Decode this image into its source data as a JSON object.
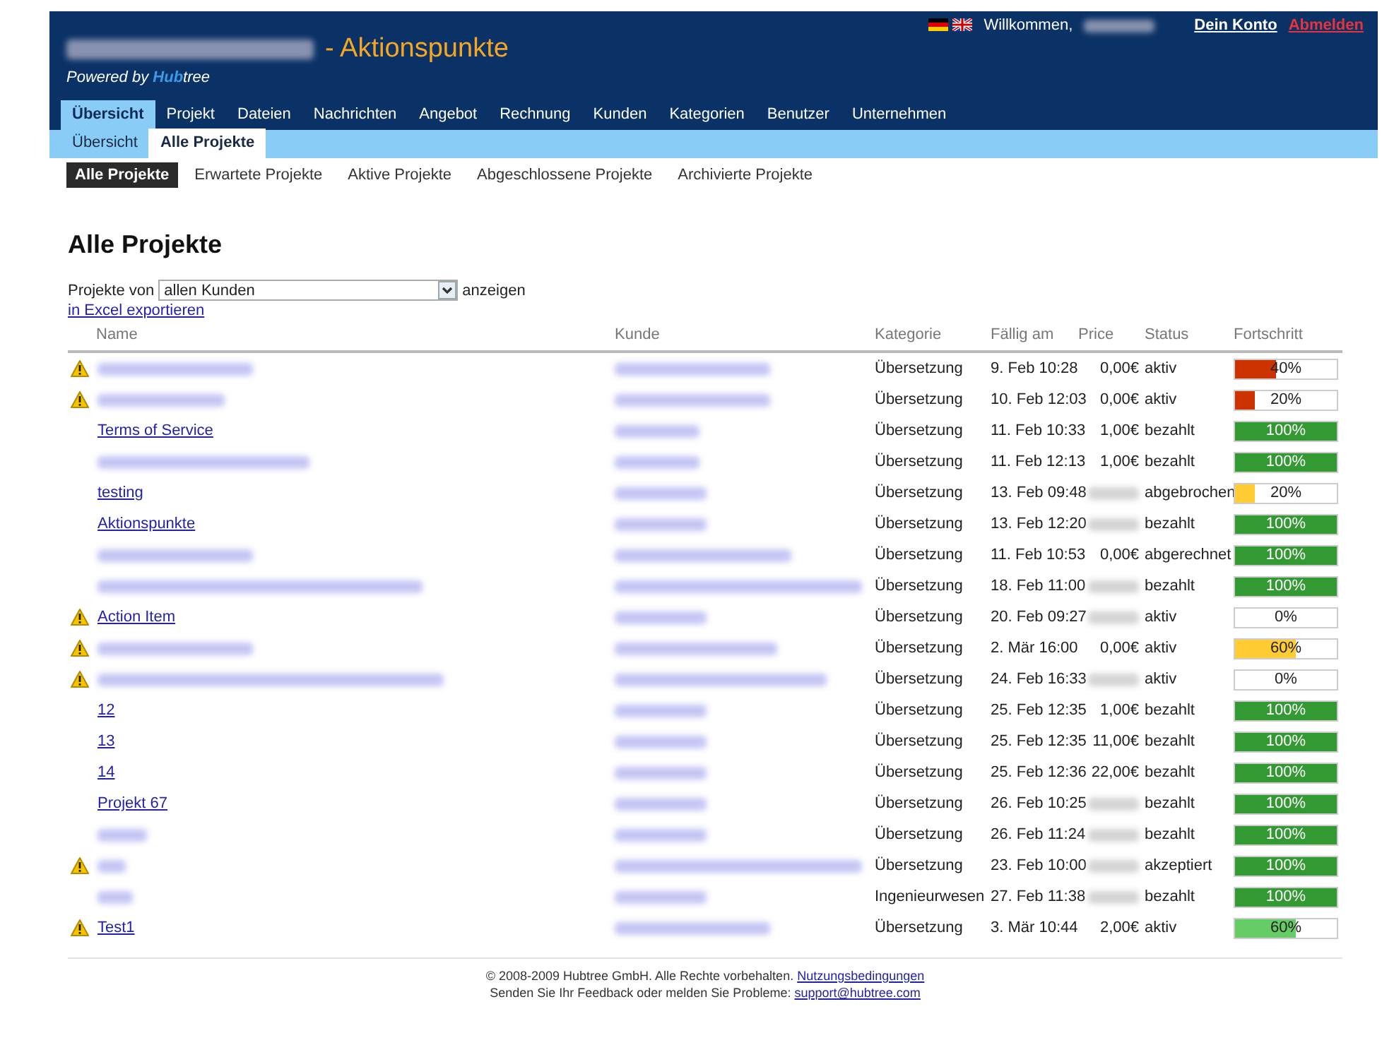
{
  "header": {
    "title_suffix": "- Aktionspunkte",
    "powered_by": {
      "prefix": "Powered by",
      "brand_first": "Hub",
      "brand_last": "tree"
    },
    "welcome": "Willkommen,",
    "account_link": "Dein Konto",
    "logout_link": "Abmelden"
  },
  "main_tabs": [
    {
      "label": "Übersicht",
      "selected": true
    },
    {
      "label": "Projekt",
      "selected": false
    },
    {
      "label": "Dateien",
      "selected": false
    },
    {
      "label": "Nachrichten",
      "selected": false
    },
    {
      "label": "Angebot",
      "selected": false
    },
    {
      "label": "Rechnung",
      "selected": false
    },
    {
      "label": "Kunden",
      "selected": false
    },
    {
      "label": "Kategorien",
      "selected": false
    },
    {
      "label": "Benutzer",
      "selected": false
    },
    {
      "label": "Unternehmen",
      "selected": false
    }
  ],
  "sub_tabs": [
    {
      "label": "Übersicht",
      "selected": false
    },
    {
      "label": "Alle Projekte",
      "selected": true
    }
  ],
  "filter_tabs": [
    {
      "label": "Alle Projekte",
      "selected": true
    },
    {
      "label": "Erwartete Projekte",
      "selected": false
    },
    {
      "label": "Aktive Projekte",
      "selected": false
    },
    {
      "label": "Abgeschlossene Projekte",
      "selected": false
    },
    {
      "label": "Archivierte Projekte",
      "selected": false
    }
  ],
  "heading": "Alle Projekte",
  "filter": {
    "prefix": "Projekte von",
    "value": "allen Kunden",
    "suffix": "anzeigen"
  },
  "export_link": "in Excel exportieren",
  "table": {
    "columns": [
      "Name",
      "Kunde",
      "Kategorie",
      "Fällig am",
      "Price",
      "Status",
      "Fortschritt"
    ],
    "rows": [
      {
        "warning": true,
        "category": "Übersetzung",
        "due": "9. Feb 10:28",
        "price": "0,00€",
        "status": "aktiv",
        "progress": {
          "level": 0.4,
          "label": "40%",
          "color": "#cc3300"
        }
      },
      {
        "warning": true,
        "category": "Übersetzung",
        "due": "10. Feb 12:03",
        "price": "0,00€",
        "status": "aktiv",
        "progress": {
          "level": 0.2,
          "label": "20%",
          "color": "#cc3300"
        }
      },
      {
        "warning": false,
        "name": "Terms of Service",
        "category": "Übersetzung",
        "due": "11. Feb 10:33",
        "price": "1,00€",
        "status": "bezahlt",
        "progress": {
          "level": 1,
          "label": "100%",
          "color": "#339933"
        }
      },
      {
        "warning": false,
        "category": "Übersetzung",
        "due": "11. Feb 12:13",
        "price": "1,00€",
        "status": "bezahlt",
        "progress": {
          "level": 1,
          "label": "100%",
          "color": "#339933"
        }
      },
      {
        "warning": false,
        "name": "testing",
        "category": "Übersetzung",
        "due": "13. Feb 09:48",
        "status": "abgebrochen",
        "progress": {
          "level": 0.2,
          "label": "20%",
          "color": "#ffcc33"
        }
      },
      {
        "warning": false,
        "name": "Aktionspunkte",
        "category": "Übersetzung",
        "due": "13. Feb 12:20",
        "status": "bezahlt",
        "progress": {
          "level": 1,
          "label": "100%",
          "color": "#339933"
        }
      },
      {
        "warning": false,
        "category": "Übersetzung",
        "due": "11. Feb 10:53",
        "price": "0,00€",
        "status": "abgerechnet",
        "progress": {
          "level": 1,
          "label": "100%",
          "color": "#339933"
        }
      },
      {
        "warning": false,
        "category": "Übersetzung",
        "due": "18. Feb 11:00",
        "status": "bezahlt",
        "progress": {
          "level": 1,
          "label": "100%",
          "color": "#339933"
        }
      },
      {
        "warning": true,
        "name": "Action Item",
        "category": "Übersetzung",
        "due": "20. Feb 09:27",
        "status": "aktiv",
        "progress": {
          "label": "0%"
        }
      },
      {
        "warning": true,
        "category": "Übersetzung",
        "due": "2. Mär 16:00",
        "price": "0,00€",
        "status": "aktiv",
        "progress": {
          "level": 0.6,
          "label": "60%",
          "color": "#ffcc33"
        }
      },
      {
        "warning": true,
        "category": "Übersetzung",
        "due": "24. Feb 16:33",
        "status": "aktiv",
        "progress": {
          "label": "0%"
        }
      },
      {
        "warning": false,
        "name": "12",
        "category": "Übersetzung",
        "due": "25. Feb 12:35",
        "price": "1,00€",
        "status": "bezahlt",
        "progress": {
          "level": 1,
          "label": "100%",
          "color": "#339933"
        }
      },
      {
        "warning": false,
        "name": "13",
        "category": "Übersetzung",
        "due": "25. Feb 12:35",
        "price": "11,00€",
        "status": "bezahlt",
        "progress": {
          "level": 1,
          "label": "100%",
          "color": "#339933"
        }
      },
      {
        "warning": false,
        "name": "14",
        "category": "Übersetzung",
        "due": "25. Feb 12:36",
        "price": "22,00€",
        "status": "bezahlt",
        "progress": {
          "level": 1,
          "label": "100%",
          "color": "#339933"
        }
      },
      {
        "warning": false,
        "name": "Projekt 67",
        "category": "Übersetzung",
        "due": "26. Feb 10:25",
        "status": "bezahlt",
        "progress": {
          "level": 1,
          "label": "100%",
          "color": "#339933"
        }
      },
      {
        "warning": false,
        "category": "Übersetzung",
        "due": "26. Feb 11:24",
        "status": "bezahlt",
        "progress": {
          "level": 1,
          "label": "100%",
          "color": "#339933"
        }
      },
      {
        "warning": true,
        "category": "Übersetzung",
        "due": "23. Feb 10:00",
        "status": "akzeptiert",
        "progress": {
          "level": 1,
          "label": "100%",
          "color": "#339933"
        }
      },
      {
        "warning": false,
        "category": "Ingenieurwesen",
        "due": "27. Feb 11:38",
        "status": "bezahlt",
        "progress": {
          "level": 1,
          "label": "100%",
          "color": "#339933"
        }
      },
      {
        "warning": true,
        "name": "Test1",
        "category": "Übersetzung",
        "due": "3. Mär 10:44",
        "price": "2,00€",
        "status": "aktiv",
        "progress": {
          "level": 0.6,
          "label": "60%",
          "color": "#66cc66"
        }
      }
    ]
  },
  "footer": {
    "copyright": "© 2008-2009 Hubtree GmbH. Alle Rechte vorbehalten.",
    "terms_link": "Nutzungsbedingungen",
    "feedback": "Senden Sie Ihr Feedback oder melden Sie Probleme:",
    "email_link": "support@hubtree.com"
  }
}
